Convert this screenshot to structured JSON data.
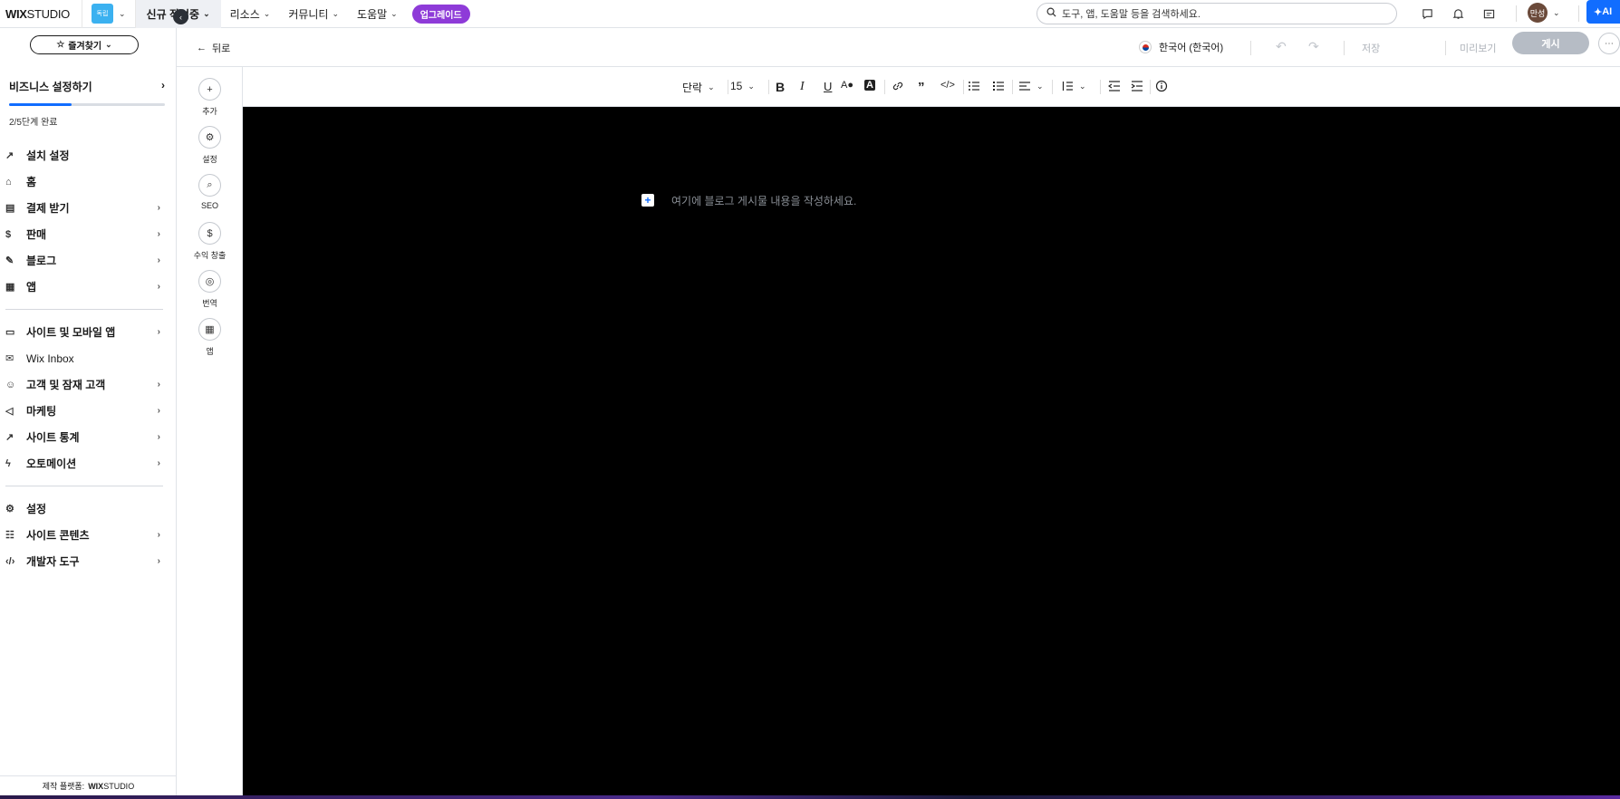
{
  "topbar": {
    "logo_bold": "WIX",
    "logo_light": "STUDIO",
    "site_thumb": "독립",
    "nav": [
      {
        "label": "신규 작업중"
      },
      {
        "label": "리소스"
      },
      {
        "label": "커뮤니티"
      },
      {
        "label": "도움말"
      }
    ],
    "upgrade_label": "업그레이드",
    "search_placeholder": "도구, 앱, 도움말 등을 검색하세요.",
    "account_label": "만성",
    "ai_label": "AI",
    "icons": [
      "chat-icon",
      "bell-icon",
      "layout-icon"
    ]
  },
  "sidebar": {
    "favorites_label": "즐겨찾기",
    "setup": {
      "title": "비즈니스 설정하기",
      "progress": 0.4,
      "subtitle": "2/5단계 완료"
    },
    "group1": [
      {
        "label": "설치 설정",
        "icon": "rocket-icon",
        "arrow": false
      },
      {
        "label": "홈",
        "icon": "home-icon",
        "arrow": false
      },
      {
        "label": "결제 받기",
        "icon": "payment-icon",
        "arrow": true
      },
      {
        "label": "판매",
        "icon": "dollar-icon",
        "arrow": true
      },
      {
        "label": "블로그",
        "icon": "pen-icon",
        "arrow": true
      },
      {
        "label": "앱",
        "icon": "apps-icon",
        "arrow": true
      }
    ],
    "group2": [
      {
        "label": "사이트 및 모바일 앱",
        "icon": "devices-icon",
        "arrow": true,
        "normal": false
      },
      {
        "label": "Wix Inbox",
        "icon": "inbox-icon",
        "arrow": false,
        "normal": true
      },
      {
        "label": "고객 및 잠재 고객",
        "icon": "people-icon",
        "arrow": true,
        "normal": false
      },
      {
        "label": "마케팅",
        "icon": "megaphone-icon",
        "arrow": true,
        "normal": false
      },
      {
        "label": "사이트 통계",
        "icon": "chart-icon",
        "arrow": true,
        "normal": false
      },
      {
        "label": "오토메이션",
        "icon": "bolt-icon",
        "arrow": true,
        "normal": false
      }
    ],
    "group3": [
      {
        "label": "설정",
        "icon": "gear-icon",
        "arrow": false
      },
      {
        "label": "사이트 콘텐츠",
        "icon": "table-icon",
        "arrow": true
      },
      {
        "label": "개발자 도구",
        "icon": "code-icon",
        "arrow": true
      }
    ],
    "footer_prefix": "제작 플랫폼:",
    "footer_brand_bold": "WIX",
    "footer_brand_light": "STUDIO"
  },
  "editor": {
    "back_label": "뒤로",
    "language": "한국어 (한국어)",
    "save_label": "저장",
    "preview_label": "미리보기",
    "publish_label": "게시",
    "rail": [
      {
        "label": "추가",
        "icon": "plus-icon"
      },
      {
        "label": "설정",
        "icon": "gear-icon"
      },
      {
        "label": "SEO",
        "icon": "search-icon"
      },
      {
        "label": "수익 창출",
        "icon": "dollar-icon"
      },
      {
        "label": "번역",
        "icon": "globe-icon"
      },
      {
        "label": "앱",
        "icon": "apps-icon"
      }
    ],
    "format": {
      "paragraph": "단락",
      "font_size": "15"
    },
    "placeholder": "여기에 블로그 게시물 내용을 작성하세요."
  }
}
